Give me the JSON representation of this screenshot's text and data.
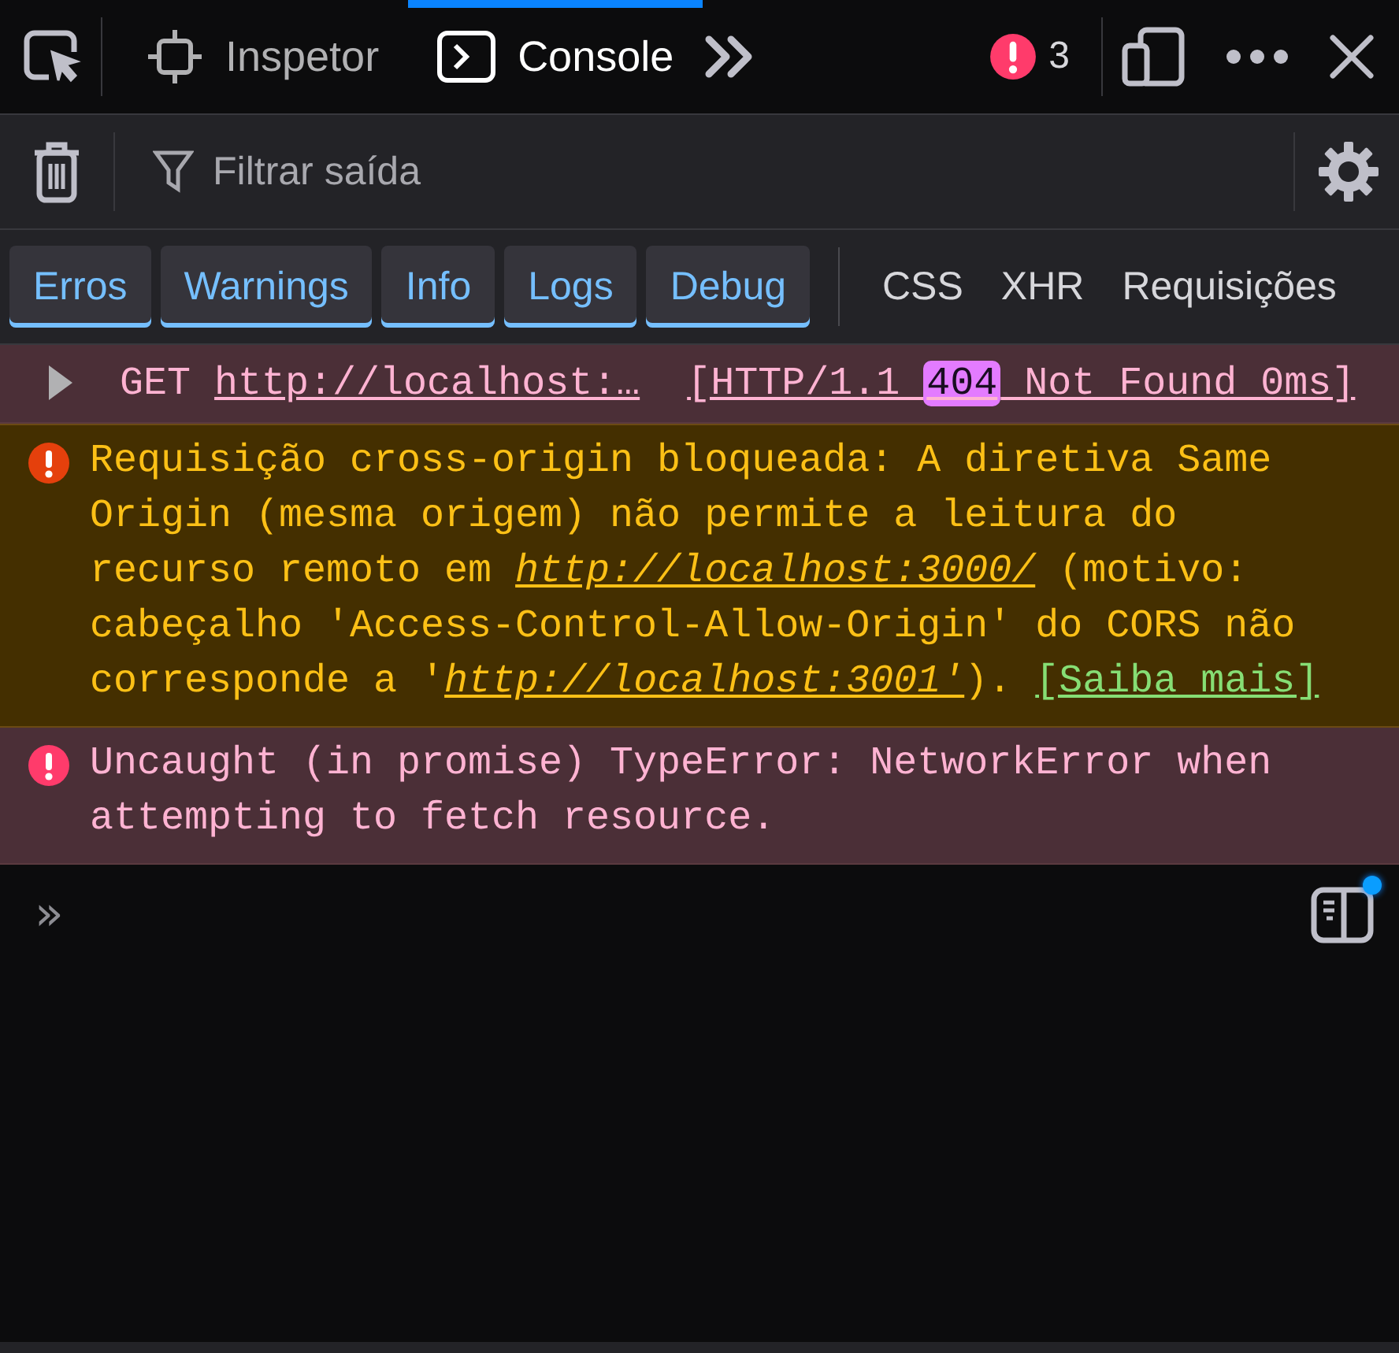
{
  "toolbar": {
    "tabs": [
      {
        "label": "Inspetor",
        "kind": "inspector",
        "selected": false
      },
      {
        "label": "Console",
        "kind": "console",
        "selected": true
      }
    ],
    "error_count": "3"
  },
  "filter": {
    "placeholder": "Filtrar saída"
  },
  "levels": [
    {
      "label": "Erros",
      "selected": true
    },
    {
      "label": "Warnings",
      "selected": true
    },
    {
      "label": "Info",
      "selected": true
    },
    {
      "label": "Logs",
      "selected": true
    },
    {
      "label": "Debug",
      "selected": true
    }
  ],
  "request_filters": [
    {
      "label": "CSS",
      "selected": false
    },
    {
      "label": "XHR",
      "selected": false
    },
    {
      "label": "Requisições",
      "selected": false
    }
  ],
  "messages": [
    {
      "kind": "network",
      "expanded": false,
      "method": "GET",
      "url": "http://localhost:…",
      "protocol": "[HTTP/1.1 ",
      "status": "404",
      "status_text": " Not Found 0ms]"
    },
    {
      "kind": "warning",
      "parts": [
        {
          "kind": "text",
          "text": "Requisição cross-origin bloqueada: A diretiva Same Origin (mesma origem) não permite a leitura do recurso remoto em "
        },
        {
          "kind": "link",
          "text": "http://localhost:3000/"
        },
        {
          "kind": "text",
          "text": " (motivo: cabeçalho 'Access-Control-Allow-Origin' do CORS não corresponde a '"
        },
        {
          "kind": "link",
          "text": "http://localhost:3001'"
        },
        {
          "kind": "text",
          "text": "). "
        },
        {
          "kind": "more",
          "text": "[Saiba mais]"
        }
      ]
    },
    {
      "kind": "error",
      "parts": [
        {
          "kind": "text",
          "text": "Uncaught (in promise) TypeError: NetworkError when attempting to fetch resource."
        }
      ]
    }
  ],
  "input": {
    "prompt": "»"
  },
  "sidebar_toggle": {
    "notification": true
  }
}
